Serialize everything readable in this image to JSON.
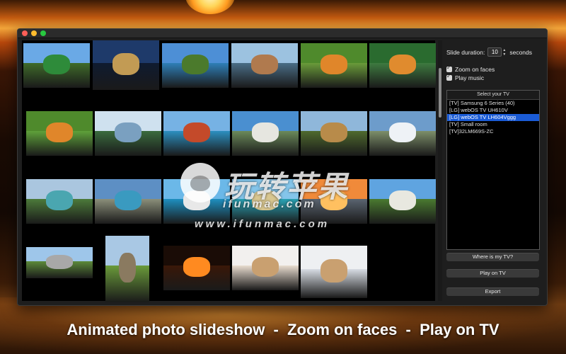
{
  "caption": "Animated photo slideshow  -  Zoom on faces  -  Play on TV",
  "watermark": {
    "cn": "玩转苹果",
    "url1": "ifunmac.com",
    "url2": "www.ifunmac.com"
  },
  "panel": {
    "slide_duration_label": "Slide duration:",
    "slide_duration_value": "10",
    "seconds_label": "seconds",
    "zoom_on_faces": "Zoom on faces",
    "play_music": "Play music",
    "tv_list_header": "Select your TV",
    "tv_list": [
      "[TV] Samsung 6 Series (40)",
      "[LG] webOS TV UH610V",
      "[LG] webOS TV LH604Vggg",
      "[TV] Small room",
      "[TV]32LM669S-ZC"
    ],
    "selected_tv_index": 2,
    "where_is_tv": "Where is my TV?",
    "play_on_tv": "Play on TV",
    "export": "Export"
  },
  "colors": {
    "selection": "#1a5bd6",
    "window": "#1e1e1e"
  },
  "photos": [
    {
      "sky": "#6aa9e6",
      "land": "#3f6b2a",
      "accent": "#2e8b3a",
      "name": "palm-tree"
    },
    {
      "sky": "#1e3a6a",
      "land": "#0f1b30",
      "accent": "#c29b54",
      "name": "castle-night"
    },
    {
      "sky": "#4d8fd6",
      "land": "#2f7fb8",
      "accent": "#4b7a2c",
      "name": "lake-village"
    },
    {
      "sky": "#9cc2e0",
      "land": "#4a6d86",
      "accent": "#b07a4e",
      "name": "castle-lake"
    },
    {
      "sky": "#4f8a2c",
      "land": "#6a9b3a",
      "accent": "#e0862a",
      "name": "tiger-grass"
    },
    {
      "sky": "#2a6b2f",
      "land": "#3e7a40",
      "accent": "#e08b2e",
      "name": "tiger-water"
    },
    {
      "sky": "#4f8a2c",
      "land": "#5fa13a",
      "accent": "#e0862a",
      "name": "tigers-field"
    },
    {
      "sky": "#cfe1ef",
      "land": "#3a6b3e",
      "accent": "#7aa0c0",
      "name": "mountain-path"
    },
    {
      "sky": "#76b2e4",
      "land": "#2c8fc0",
      "accent": "#c44a2a",
      "name": "red-houses"
    },
    {
      "sky": "#4a8fd0",
      "land": "#6b8a5a",
      "accent": "#e6e6e0",
      "name": "neuschwanstein"
    },
    {
      "sky": "#8fb7da",
      "land": "#4f6a2e",
      "accent": "#b88b4a",
      "name": "autumn-lake"
    },
    {
      "sky": "#6d9ccb",
      "land": "#7d8f6a",
      "accent": "#eef2f6",
      "name": "snow-mountains"
    },
    {
      "sky": "#aac6df",
      "land": "#4c7a3a",
      "accent": "#4aa6b0",
      "name": "alpine-lake"
    },
    {
      "sky": "#5d8fc4",
      "land": "#8b8f7a",
      "accent": "#3a9ac0",
      "name": "mountain-river"
    },
    {
      "sky": "#6bb8e8",
      "land": "#1e8fc0",
      "accent": "#e8e8e8",
      "name": "coast-cliffs"
    },
    {
      "sky": "#84c5ea",
      "land": "#2aa3b5",
      "accent": "#d8c690",
      "name": "tropical-bay"
    },
    {
      "sky": "#f08a3a",
      "land": "#5a6470",
      "accent": "#ffc060",
      "name": "sunset-beach"
    },
    {
      "sky": "#5fa4e0",
      "land": "#4a7a30",
      "accent": "#e8e8e0",
      "name": "cliff-valley"
    },
    {
      "sky": "#9ec6ea",
      "land": "#5c8a3a",
      "accent": "#a8a8a8",
      "name": "castle-tower"
    },
    {
      "sky": "#a9c8e4",
      "land": "#6a9a3a",
      "accent": "#8a7a60",
      "name": "field-road"
    },
    {
      "sky": "#1a0c06",
      "land": "#3a1808",
      "accent": "#ff8a20",
      "name": "night-fire"
    },
    {
      "sky": "#f2f0ee",
      "land": "#e8dccf",
      "accent": "#c9a070",
      "name": "woman-portrait"
    },
    {
      "sky": "#eef0f2",
      "land": "#d8dde4",
      "accent": "#c9a070",
      "name": "woman-desk"
    }
  ]
}
